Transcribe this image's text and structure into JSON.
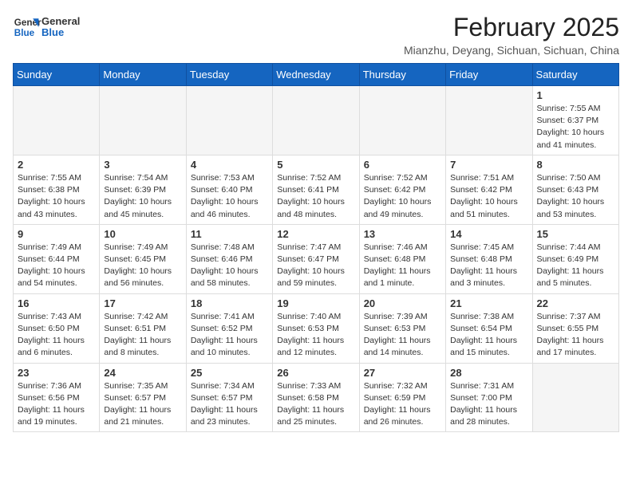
{
  "logo": {
    "line1": "General",
    "line2": "Blue"
  },
  "title": "February 2025",
  "location": "Mianzhu, Deyang, Sichuan, Sichuan, China",
  "weekdays": [
    "Sunday",
    "Monday",
    "Tuesday",
    "Wednesday",
    "Thursday",
    "Friday",
    "Saturday"
  ],
  "weeks": [
    [
      {
        "day": "",
        "info": ""
      },
      {
        "day": "",
        "info": ""
      },
      {
        "day": "",
        "info": ""
      },
      {
        "day": "",
        "info": ""
      },
      {
        "day": "",
        "info": ""
      },
      {
        "day": "",
        "info": ""
      },
      {
        "day": "1",
        "info": "Sunrise: 7:55 AM\nSunset: 6:37 PM\nDaylight: 10 hours\nand 41 minutes."
      }
    ],
    [
      {
        "day": "2",
        "info": "Sunrise: 7:55 AM\nSunset: 6:38 PM\nDaylight: 10 hours\nand 43 minutes."
      },
      {
        "day": "3",
        "info": "Sunrise: 7:54 AM\nSunset: 6:39 PM\nDaylight: 10 hours\nand 45 minutes."
      },
      {
        "day": "4",
        "info": "Sunrise: 7:53 AM\nSunset: 6:40 PM\nDaylight: 10 hours\nand 46 minutes."
      },
      {
        "day": "5",
        "info": "Sunrise: 7:52 AM\nSunset: 6:41 PM\nDaylight: 10 hours\nand 48 minutes."
      },
      {
        "day": "6",
        "info": "Sunrise: 7:52 AM\nSunset: 6:42 PM\nDaylight: 10 hours\nand 49 minutes."
      },
      {
        "day": "7",
        "info": "Sunrise: 7:51 AM\nSunset: 6:42 PM\nDaylight: 10 hours\nand 51 minutes."
      },
      {
        "day": "8",
        "info": "Sunrise: 7:50 AM\nSunset: 6:43 PM\nDaylight: 10 hours\nand 53 minutes."
      }
    ],
    [
      {
        "day": "9",
        "info": "Sunrise: 7:49 AM\nSunset: 6:44 PM\nDaylight: 10 hours\nand 54 minutes."
      },
      {
        "day": "10",
        "info": "Sunrise: 7:49 AM\nSunset: 6:45 PM\nDaylight: 10 hours\nand 56 minutes."
      },
      {
        "day": "11",
        "info": "Sunrise: 7:48 AM\nSunset: 6:46 PM\nDaylight: 10 hours\nand 58 minutes."
      },
      {
        "day": "12",
        "info": "Sunrise: 7:47 AM\nSunset: 6:47 PM\nDaylight: 10 hours\nand 59 minutes."
      },
      {
        "day": "13",
        "info": "Sunrise: 7:46 AM\nSunset: 6:48 PM\nDaylight: 11 hours\nand 1 minute."
      },
      {
        "day": "14",
        "info": "Sunrise: 7:45 AM\nSunset: 6:48 PM\nDaylight: 11 hours\nand 3 minutes."
      },
      {
        "day": "15",
        "info": "Sunrise: 7:44 AM\nSunset: 6:49 PM\nDaylight: 11 hours\nand 5 minutes."
      }
    ],
    [
      {
        "day": "16",
        "info": "Sunrise: 7:43 AM\nSunset: 6:50 PM\nDaylight: 11 hours\nand 6 minutes."
      },
      {
        "day": "17",
        "info": "Sunrise: 7:42 AM\nSunset: 6:51 PM\nDaylight: 11 hours\nand 8 minutes."
      },
      {
        "day": "18",
        "info": "Sunrise: 7:41 AM\nSunset: 6:52 PM\nDaylight: 11 hours\nand 10 minutes."
      },
      {
        "day": "19",
        "info": "Sunrise: 7:40 AM\nSunset: 6:53 PM\nDaylight: 11 hours\nand 12 minutes."
      },
      {
        "day": "20",
        "info": "Sunrise: 7:39 AM\nSunset: 6:53 PM\nDaylight: 11 hours\nand 14 minutes."
      },
      {
        "day": "21",
        "info": "Sunrise: 7:38 AM\nSunset: 6:54 PM\nDaylight: 11 hours\nand 15 minutes."
      },
      {
        "day": "22",
        "info": "Sunrise: 7:37 AM\nSunset: 6:55 PM\nDaylight: 11 hours\nand 17 minutes."
      }
    ],
    [
      {
        "day": "23",
        "info": "Sunrise: 7:36 AM\nSunset: 6:56 PM\nDaylight: 11 hours\nand 19 minutes."
      },
      {
        "day": "24",
        "info": "Sunrise: 7:35 AM\nSunset: 6:57 PM\nDaylight: 11 hours\nand 21 minutes."
      },
      {
        "day": "25",
        "info": "Sunrise: 7:34 AM\nSunset: 6:57 PM\nDaylight: 11 hours\nand 23 minutes."
      },
      {
        "day": "26",
        "info": "Sunrise: 7:33 AM\nSunset: 6:58 PM\nDaylight: 11 hours\nand 25 minutes."
      },
      {
        "day": "27",
        "info": "Sunrise: 7:32 AM\nSunset: 6:59 PM\nDaylight: 11 hours\nand 26 minutes."
      },
      {
        "day": "28",
        "info": "Sunrise: 7:31 AM\nSunset: 7:00 PM\nDaylight: 11 hours\nand 28 minutes."
      },
      {
        "day": "",
        "info": ""
      }
    ]
  ]
}
